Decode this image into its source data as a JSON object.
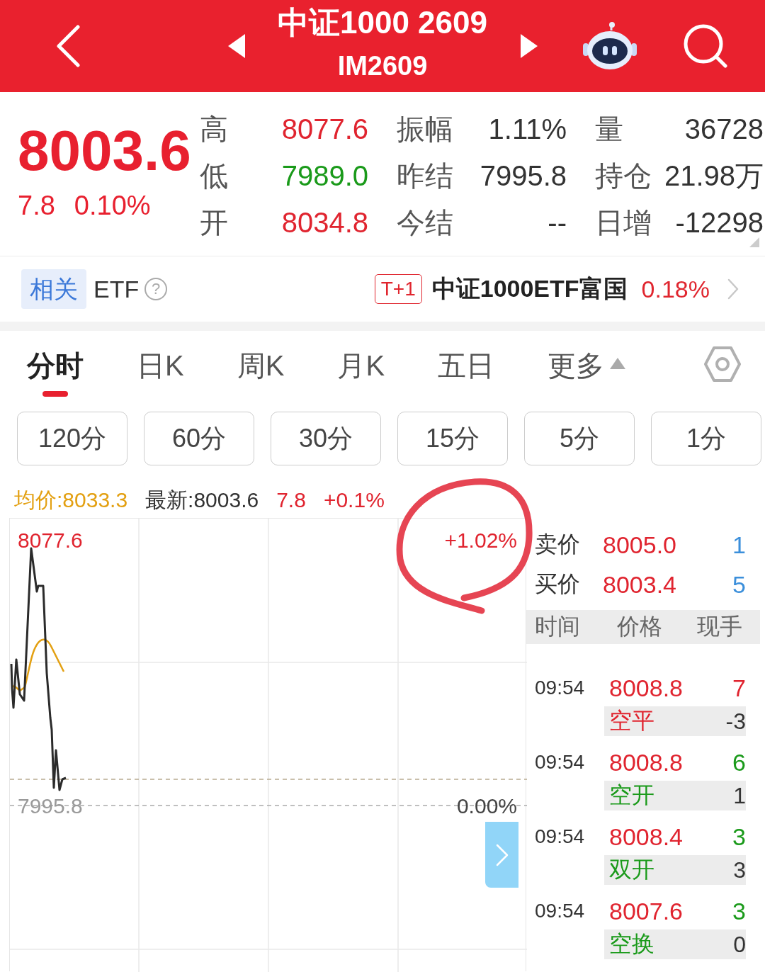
{
  "header": {
    "title": "中证1000 2609",
    "subtitle": "IM2609"
  },
  "quote": {
    "price": "8003.6",
    "change": "7.8",
    "change_percent": "0.10%"
  },
  "stats": [
    {
      "label": "高",
      "value": "8077.6",
      "color": "#e0242f"
    },
    {
      "label": "振幅",
      "value": "1.11%",
      "color": "#333333"
    },
    {
      "label": "量",
      "value": "36728",
      "color": "#333333"
    },
    {
      "label": "低",
      "value": "7989.0",
      "color": "#1a9a1a"
    },
    {
      "label": "昨结",
      "value": "7995.8",
      "color": "#333333"
    },
    {
      "label": "持仓",
      "value": "21.98万",
      "color": "#333333"
    },
    {
      "label": "开",
      "value": "8034.8",
      "color": "#e0242f"
    },
    {
      "label": "今结",
      "value": "--",
      "color": "#333333"
    },
    {
      "label": "日增",
      "value": "-12298",
      "color": "#333333"
    }
  ],
  "related_etf": {
    "tag": "相关",
    "label": "ETF",
    "help": "?",
    "badge": "T+1",
    "name": "中证1000ETF富国",
    "change": "0.18%"
  },
  "chart_tabs": [
    {
      "label": "分时",
      "kind": "tab",
      "selected": true
    },
    {
      "label": "日K",
      "kind": "tab",
      "selected": false
    },
    {
      "label": "周K",
      "kind": "tab",
      "selected": false
    },
    {
      "label": "月K",
      "kind": "tab",
      "selected": false
    },
    {
      "label": "五日",
      "kind": "tab",
      "selected": false
    },
    {
      "label": "更多",
      "kind": "menu",
      "selected": false
    }
  ],
  "periods": [
    "120分",
    "60分",
    "30分",
    "15分",
    "5分",
    "1分"
  ],
  "chart_legend": [
    {
      "label": "均价:8033.3",
      "color": "#e3a012"
    },
    {
      "label": "最新:8003.6",
      "color": "#333333"
    },
    {
      "label": "7.8",
      "color": "#e0242f"
    },
    {
      "label": "+0.1%",
      "color": "#e0242f"
    }
  ],
  "chart": {
    "price_high": "8077.6",
    "change_high": "+1.02%",
    "price_base": "7995.8",
    "change_base": "0.00%"
  },
  "order_book": [
    {
      "label": "卖价",
      "price": "8005.0",
      "volume": "1"
    },
    {
      "label": "买价",
      "price": "8003.4",
      "volume": "5"
    }
  ],
  "trades_columns": [
    "时间",
    "价格",
    "现手"
  ],
  "trades": [
    {
      "time": "09:54",
      "price": "8008.8",
      "volume": "7",
      "type": "空平",
      "change": "-3",
      "color": "#e0242f"
    },
    {
      "time": "09:54",
      "price": "8008.8",
      "volume": "6",
      "type": "空开",
      "change": "1",
      "color": "#1a9a1a"
    },
    {
      "time": "09:54",
      "price": "8008.4",
      "volume": "3",
      "type": "双开",
      "change": "3",
      "color": "#1a9a1a"
    },
    {
      "time": "09:54",
      "price": "8007.6",
      "volume": "3",
      "type": "空换",
      "change": "0",
      "color": "#1a9a1a"
    }
  ]
}
